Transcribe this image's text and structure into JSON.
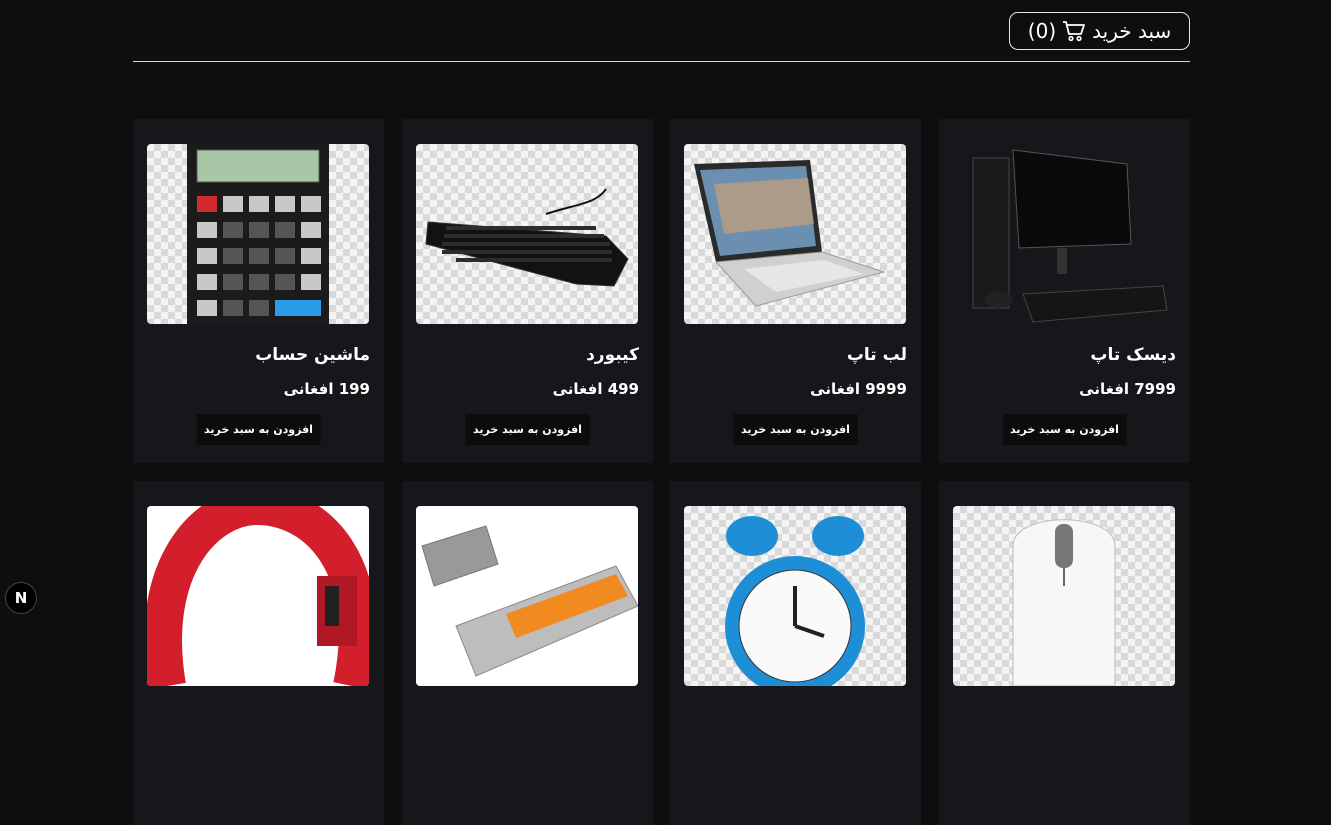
{
  "header": {
    "cart_label": "سبد خرید",
    "cart_count": "(0)"
  },
  "products": [
    {
      "name": "ماشین حساب",
      "price": "199 افغانی",
      "button": "افزودن به سبد خرید",
      "icon": "calculator-icon"
    },
    {
      "name": "کیبورد",
      "price": "499 افغانی",
      "button": "افزودن به سبد خرید",
      "icon": "keyboard-icon"
    },
    {
      "name": "لب تاپ",
      "price": "9999 افغانی",
      "button": "افزودن به سبد خرید",
      "icon": "laptop-icon"
    },
    {
      "name": "دیسک تاپ",
      "price": "7999 افغانی",
      "button": "افزودن به سبد خرید",
      "icon": "desktop-icon"
    },
    {
      "name": "",
      "price": "",
      "button": "",
      "icon": "headphones-icon"
    },
    {
      "name": "",
      "price": "",
      "button": "",
      "icon": "usb-drive-icon"
    },
    {
      "name": "",
      "price": "",
      "button": "",
      "icon": "alarm-clock-icon"
    },
    {
      "name": "",
      "price": "",
      "button": "",
      "icon": "mouse-icon"
    }
  ],
  "badge": {
    "letter": "N"
  },
  "colors": {
    "background": "#0e0e0f",
    "card": "#16171a",
    "button": "#0c0c0d"
  }
}
